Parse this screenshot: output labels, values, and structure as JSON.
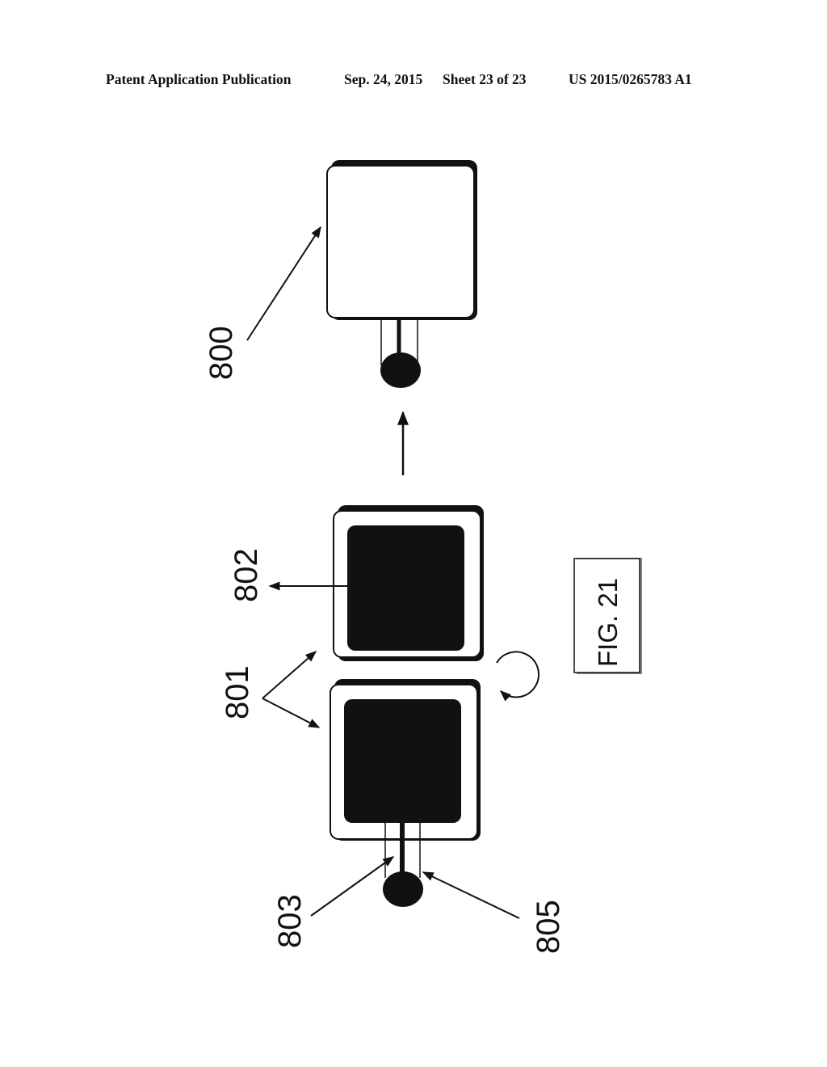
{
  "header": {
    "publication": "Patent Application Publication",
    "date": "Sep. 24, 2015",
    "sheet": "Sheet 23 of 23",
    "number": "US 2015/0265783 A1"
  },
  "figure": {
    "caption": "FIG. 21",
    "labels": {
      "device_800": "800",
      "parts_801": "801",
      "element_802": "802",
      "element_803": "803",
      "element_805": "805"
    }
  }
}
